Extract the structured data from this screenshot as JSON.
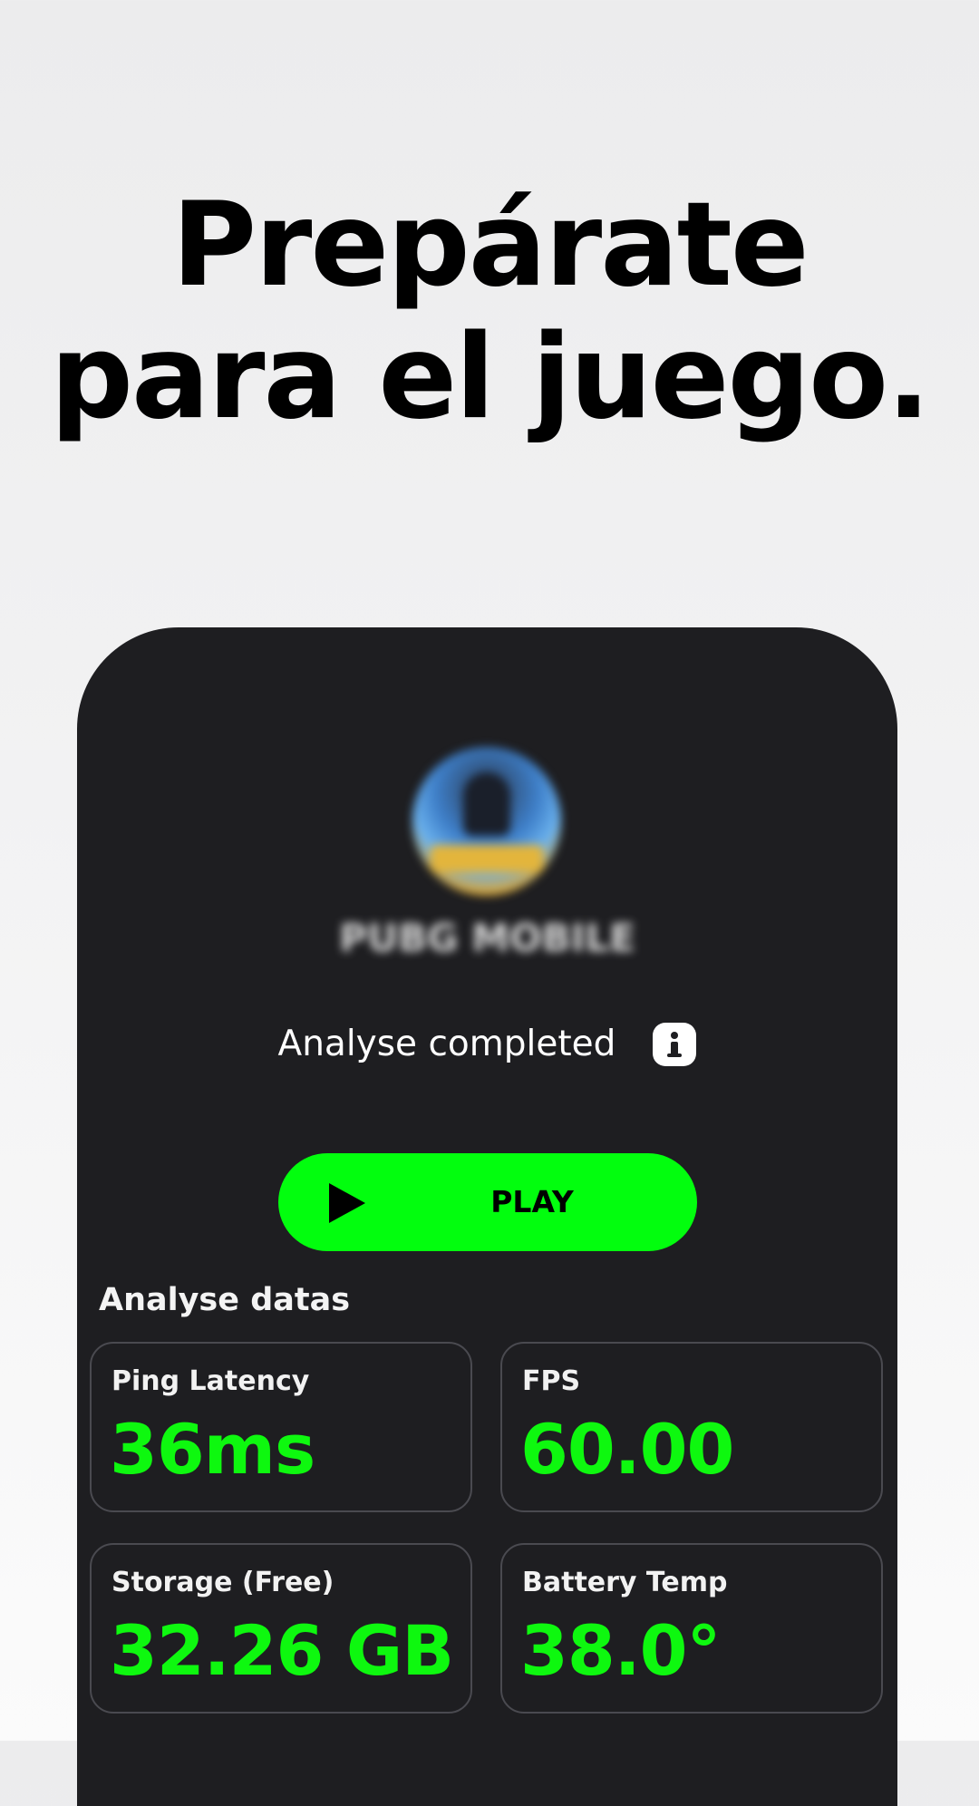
{
  "headline": {
    "line1": "Prepárate",
    "line2": "para el juego."
  },
  "game": {
    "name": "PUBG MOBILE",
    "icon": "game-avatar-icon"
  },
  "status": {
    "text": "Analyse completed",
    "info_icon": "info-icon"
  },
  "play_button": {
    "label": "PLAY",
    "icon": "play-icon"
  },
  "analysis": {
    "title": "Analyse datas",
    "stats": [
      {
        "label": "Ping Latency",
        "value": "36ms"
      },
      {
        "label": "FPS",
        "value": "60.00"
      },
      {
        "label": "Storage (Free)",
        "value": "32.26 GB"
      },
      {
        "label": "Battery Temp",
        "value": "38.0°"
      }
    ]
  },
  "colors": {
    "accent": "#02fe0e",
    "card_background": "#1e1e21",
    "value_text": "#0ef80f",
    "page_background": "#f0f0f1"
  }
}
